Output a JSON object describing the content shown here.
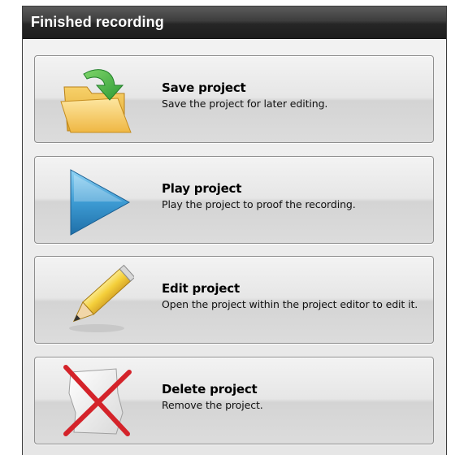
{
  "window": {
    "title": "Finished recording"
  },
  "actions": [
    {
      "id": "save",
      "title": "Save project",
      "description": "Save the project for later editing.",
      "icon": "folder-save-icon"
    },
    {
      "id": "play",
      "title": "Play project",
      "description": "Play the project to proof the recording.",
      "icon": "play-icon"
    },
    {
      "id": "edit",
      "title": "Edit project",
      "description": "Open the project within the project editor to edit it.",
      "icon": "pencil-icon"
    },
    {
      "id": "delete",
      "title": "Delete project",
      "description": "Remove the project.",
      "icon": "delete-icon"
    }
  ],
  "colors": {
    "titlebar": "#262626",
    "button_border": "#8e8e8e",
    "delete_cross": "#d4232a",
    "play_triangle": "#2b88c2",
    "folder": "#f3c24b",
    "arrow": "#3fae3f",
    "pencil": "#f6d84a"
  }
}
